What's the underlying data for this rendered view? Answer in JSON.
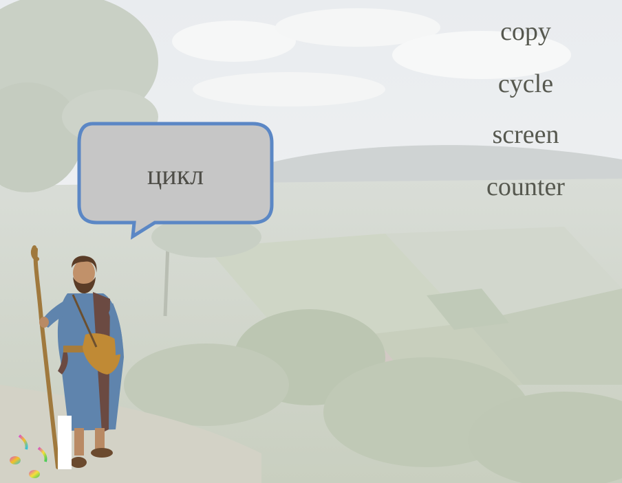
{
  "bubble": {
    "word": "цикл"
  },
  "options": [
    {
      "label": "copy"
    },
    {
      "label": "cycle"
    },
    {
      "label": "screen"
    },
    {
      "label": "counter"
    }
  ],
  "colors": {
    "bubble_border": "#5b87c5",
    "bubble_fill": "#c6c6c6",
    "word_text": "#56584f"
  },
  "icons": [
    "music-note-icon",
    "traveler-character"
  ]
}
